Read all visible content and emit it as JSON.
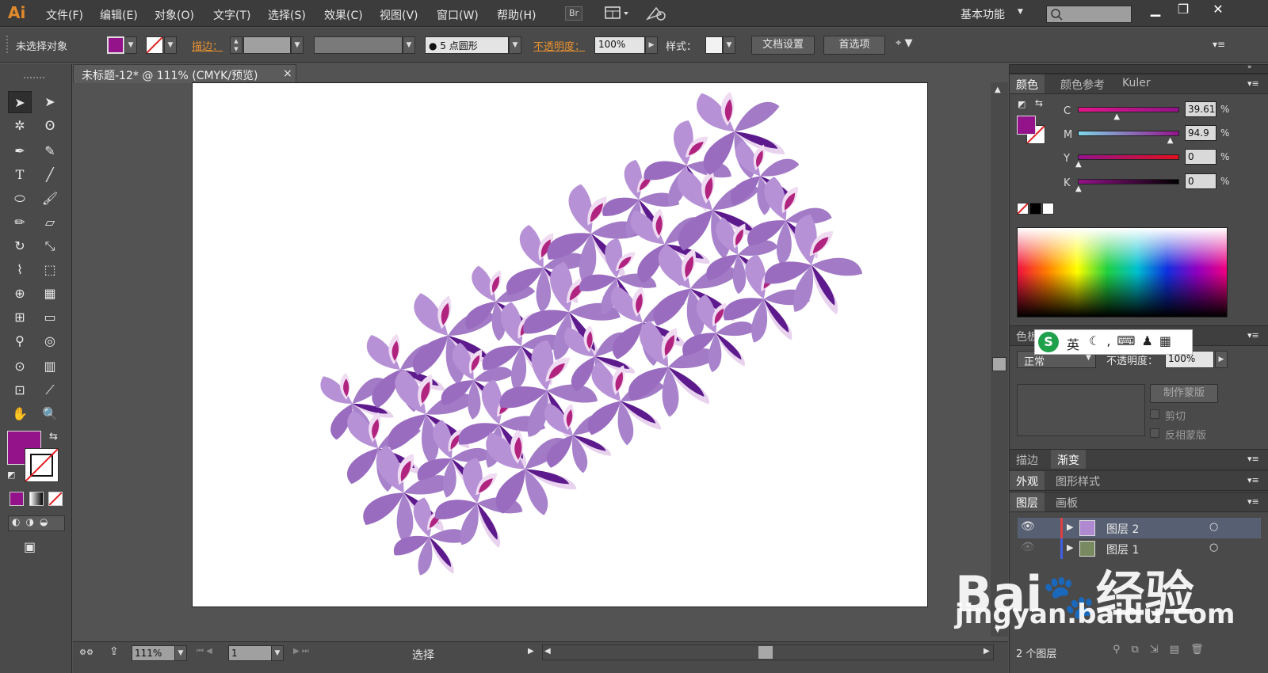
{
  "menubar": {
    "logo": "Ai",
    "items": [
      "文件(F)",
      "编辑(E)",
      "对象(O)",
      "文字(T)",
      "选择(S)",
      "效果(C)",
      "视图(V)",
      "窗口(W)",
      "帮助(H)"
    ],
    "bridge_label": "Br",
    "workspace": "基本功能",
    "window_controls": [
      "minimize-icon",
      "restore-icon",
      "close-icon"
    ]
  },
  "control_bar": {
    "selection_status": "未选择对象",
    "fill_color": "#94128a",
    "stroke_label": "描边：",
    "brush_label": "5 点圆形",
    "opacity_label": "不透明度：",
    "opacity_value": "100%",
    "style_label": "样式：",
    "doc_setup_button": "文档设置",
    "preferences_button": "首选项"
  },
  "document": {
    "tab_title": "未标题-12* @ 111% (CMYK/预览)",
    "tab_close": "×",
    "artwork": "purple orchid flower cluster"
  },
  "statusbar": {
    "zoom": "111%",
    "artboard_number": "1",
    "tool_status": "选择"
  },
  "color_panel": {
    "tabs": [
      "颜色",
      "颜色参考",
      "Kuler"
    ],
    "fill": "#94128a",
    "channels": [
      {
        "label": "C",
        "value": "39.61",
        "unit": "%",
        "level": 0.3961
      },
      {
        "label": "M",
        "value": "94.9",
        "unit": "%",
        "level": 0.949
      },
      {
        "label": "Y",
        "value": "0",
        "unit": "%",
        "level": 0
      },
      {
        "label": "K",
        "value": "0",
        "unit": "%",
        "level": 0
      }
    ]
  },
  "transparency_panel": {
    "tab_visible": "色板",
    "blend_mode": "正常",
    "opacity_label": "不透明度：",
    "opacity_value": "100%",
    "make_mask_button": "制作蒙版",
    "clip_label": "剪切",
    "invert_label": "反相蒙版"
  },
  "ime": {
    "lang": "英"
  },
  "panels": {
    "stroke_tab": "描边",
    "gradient_tab": "渐变",
    "appearance_tab": "外观",
    "graphic_style_tab": "图形样式",
    "layers_tab": "图层",
    "artboards_tab": "画板"
  },
  "layers": {
    "rows": [
      {
        "name": "图层 2"
      },
      {
        "name": "图层 1"
      }
    ],
    "count_label": "2 个图层"
  },
  "watermark": {
    "brand": "Bai",
    "brand2": "经验",
    "url": "jingyan.baidu.com"
  },
  "colors": {
    "accent_purple": "#94128a",
    "petal_light": "#a678c8",
    "petal_dark": "#5c1a8c"
  }
}
